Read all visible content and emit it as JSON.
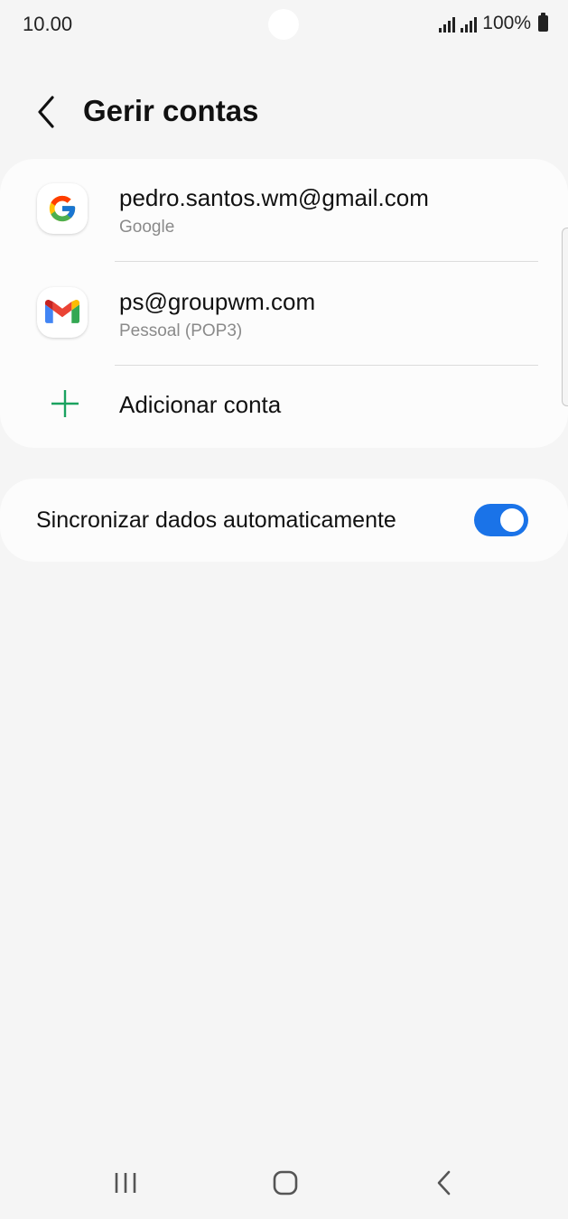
{
  "status_bar": {
    "time": "10.00",
    "battery": "100%"
  },
  "header": {
    "title": "Gerir contas",
    "back_icon": "chevron-left-icon"
  },
  "accounts": [
    {
      "email": "pedro.santos.wm@gmail.com",
      "type": "Google",
      "icon": "google-icon"
    },
    {
      "email": "ps@groupwm.com",
      "type": "Pessoal (POP3)",
      "icon": "gmail-icon"
    }
  ],
  "add_account": {
    "label": "Adicionar conta",
    "icon": "plus-icon",
    "icon_color": "#1aa260"
  },
  "sync": {
    "label": "Sincronizar dados automaticamente",
    "enabled": true,
    "toggle_color": "#1a73e8"
  },
  "nav": {
    "recents_icon": "recents-icon",
    "home_icon": "home-icon",
    "back_icon": "back-icon"
  }
}
